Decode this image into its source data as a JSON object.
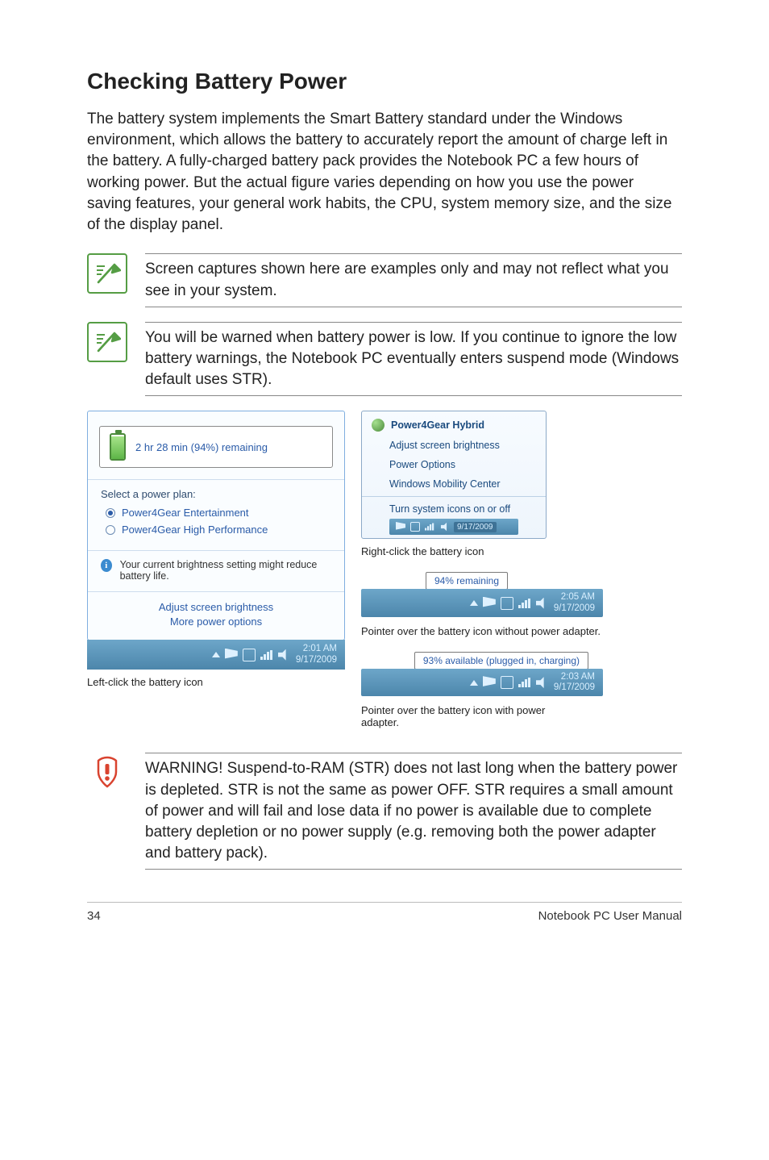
{
  "heading": "Checking Battery Power",
  "intro": "The battery system implements the Smart Battery standard under the Windows environment, which allows the battery to accurately report the amount of charge left in the battery. A fully-charged battery pack provides the Notebook PC a few hours of working power. But the actual figure varies depending on how you use the power saving features, your general work habits, the CPU, system memory size, and the size of the display panel.",
  "note1": "Screen captures shown here are examples only and may not reflect what you see in your system.",
  "note2": "You will be warned when battery power is low. If you continue to ignore the low battery warnings, the Notebook PC eventually enters suspend mode (Windows default uses STR).",
  "left_fig": {
    "tooltip": "2 hr 28 min (94%) remaining",
    "plan_header": "Select a power plan:",
    "plan1": "Power4Gear Entertainment",
    "plan2": "Power4Gear High Performance",
    "info": "Your current brightness setting might reduce battery life.",
    "link1": "Adjust screen brightness",
    "link2": "More power options",
    "clock_time": "2:01 AM",
    "clock_date": "9/17/2009",
    "caption": "Left-click the battery icon"
  },
  "ctx": {
    "head": "Power4Gear Hybrid",
    "i1": "Adjust screen brightness",
    "i2": "Power Options",
    "i3": "Windows Mobility Center",
    "i4": "Turn system icons on or off",
    "date": "9/17/2009",
    "caption": "Right-click the battery icon"
  },
  "mid": {
    "tip": "94% remaining",
    "time": "2:05 AM",
    "date": "9/17/2009",
    "caption": "Pointer over the battery icon without power adapter."
  },
  "bot": {
    "tip": "93% available (plugged in, charging)",
    "time": "2:03 AM",
    "date": "9/17/2009",
    "caption": "Pointer over the battery icon with power adapter."
  },
  "warning": "WARNING!  Suspend-to-RAM (STR) does not last long when the battery power is depleted. STR is not the same as power OFF. STR requires a small amount of power and will fail and lose data if no power is available due to complete battery depletion or no power supply (e.g. removing both the power adapter and battery pack).",
  "footer": {
    "page": "34",
    "title": "Notebook PC User Manual"
  }
}
